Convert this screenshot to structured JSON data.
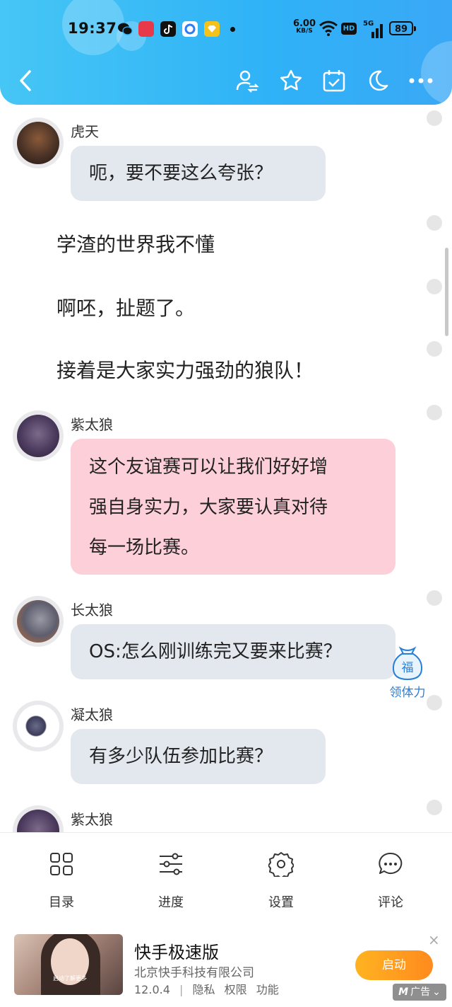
{
  "status_bar": {
    "time": "19:37",
    "net_speed_value": "6.00",
    "net_speed_unit": "KB/S",
    "hd_label": "HD",
    "signal_label": "5G",
    "battery": "89"
  },
  "toolbar": {
    "icons": [
      "back-icon",
      "user-swap-icon",
      "star-icon",
      "calendar-check-icon",
      "moon-icon",
      "more-icon"
    ]
  },
  "chat": {
    "messages": [
      {
        "type": "character",
        "name": "虎天",
        "text": "呃，要不要这么夸张？",
        "bubble": "gray"
      },
      {
        "type": "narration",
        "text": "学渣的世界我不懂"
      },
      {
        "type": "narration",
        "text": "啊呸，扯题了。"
      },
      {
        "type": "narration",
        "text": "接着是大家实力强劲的狼队！"
      },
      {
        "type": "character",
        "name": "紫太狼",
        "text_lines": [
          "这个友谊赛可以让我们好好增",
          "强自身实力，大家要认真对待",
          "每一场比赛。"
        ],
        "bubble": "pink"
      },
      {
        "type": "character",
        "name": "长太狼",
        "text": "OS:怎么刚训练完又要来比赛？",
        "bubble": "gray"
      },
      {
        "type": "character",
        "name": "凝太狼",
        "text": "有多少队伍参加比赛？",
        "bubble": "gray"
      },
      {
        "type": "character",
        "name": "紫太狼",
        "text": "",
        "bubble": "none"
      }
    ],
    "fortune_badge": {
      "glyph": "福",
      "label": "领体力"
    }
  },
  "bottom_nav": {
    "items": [
      {
        "label": "目录",
        "icon": "grid-icon"
      },
      {
        "label": "进度",
        "icon": "sliders-icon"
      },
      {
        "label": "设置",
        "icon": "gear-icon"
      },
      {
        "label": "评论",
        "icon": "comment-icon"
      }
    ]
  },
  "ad": {
    "thumb_caption": "启动了解更多",
    "title": "快手极速版",
    "company": "北京快手科技有限公司",
    "version": "12.0.4",
    "separator": "|",
    "links": [
      "隐私",
      "权限",
      "功能"
    ],
    "button": "启动",
    "close": "×",
    "tag": "广告",
    "tag_mark": "M",
    "tag_chevron": "⌄"
  },
  "colors": {
    "header": "#2fb2f7",
    "gray_bubble": "#e3e8ef",
    "pink_bubble": "#fccfd9",
    "accent_orange": "#ff9a1f",
    "link_blue": "#2a7fd6"
  }
}
